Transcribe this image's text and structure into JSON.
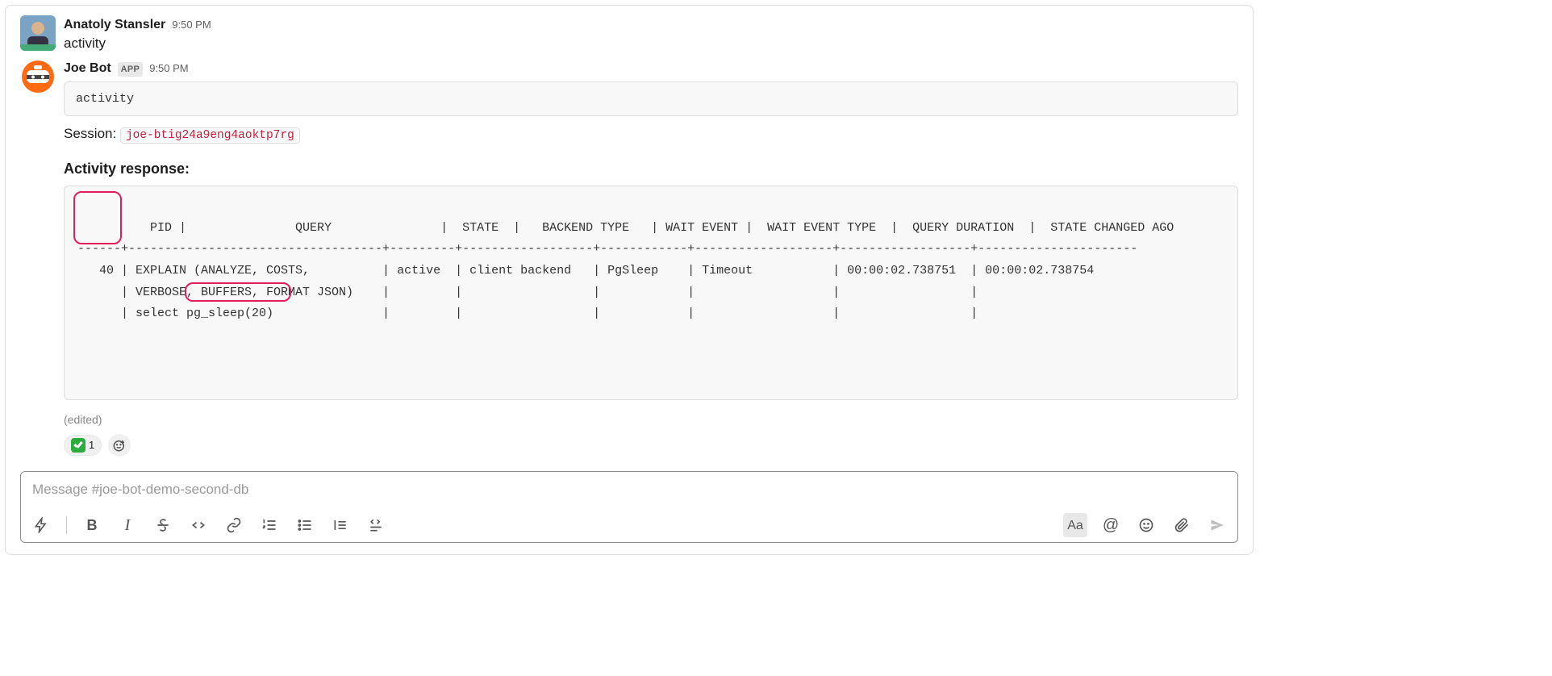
{
  "msg1": {
    "sender": "Anatoly Stansler",
    "time": "9:50 PM",
    "text": "activity"
  },
  "msg2": {
    "sender": "Joe Bot",
    "app_badge": "APP",
    "time": "9:50 PM",
    "code": "activity",
    "session_label": "Session: ",
    "session_id": "joe-btig24a9eng4aoktp7rg",
    "resp_title": "Activity response:",
    "table_text": "  PID |               QUERY               |  STATE  |   BACKEND TYPE   | WAIT EVENT |  WAIT EVENT TYPE  |  QUERY DURATION  |  STATE CHANGED AGO   \n------+-----------------------------------+---------+------------------+------------+-------------------+------------------+----------------------\n   40 | EXPLAIN (ANALYZE, COSTS,          | active  | client backend   | PgSleep    | Timeout           | 00:00:02.738751  | 00:00:02.738754     \n      | VERBOSE, BUFFERS, FORMAT JSON)    |         |                  |            |                   |                  |                     \n      | select pg_sleep(20)               |         |                  |            |                   |                  |                     ",
    "edited": "(edited)",
    "reaction_count": "1"
  },
  "composer": {
    "placeholder": "Message #joe-bot-demo-second-db"
  },
  "toolbar": {
    "bold": "B",
    "italic": "I",
    "aa": "Aa",
    "mention": "@"
  }
}
